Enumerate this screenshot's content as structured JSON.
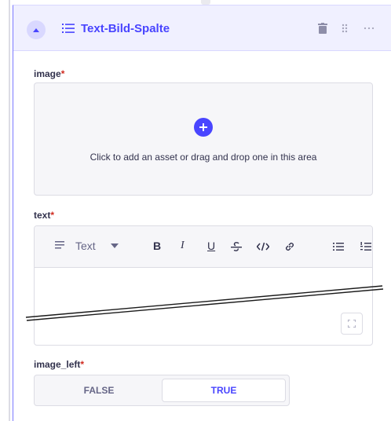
{
  "header": {
    "title": "Text-Bild-Spalte"
  },
  "fields": {
    "image": {
      "label": "image",
      "required_mark": "*",
      "drop_text": "Click to add an asset or drag and drop one in this area"
    },
    "text": {
      "label": "text",
      "required_mark": "*",
      "heading_select": "Text"
    },
    "image_left": {
      "label": "image_left",
      "required_mark": "*",
      "options": [
        "FALSE",
        "TRUE"
      ],
      "selected": "TRUE"
    }
  },
  "toolbar": {
    "bold": "B",
    "italic": "I",
    "underline": "U"
  },
  "icons": [
    "chevron-up-icon",
    "list-icon",
    "trash-icon",
    "drag-handle-icon",
    "more-icon",
    "plus-icon",
    "align-left-icon",
    "caret-down-icon",
    "strikethrough-icon",
    "code-icon",
    "link-icon",
    "bullet-list-icon",
    "numbered-list-icon",
    "expand-icon"
  ],
  "colors": {
    "accent": "#4945ff",
    "header_bg": "#f0f0ff",
    "required": "#d02b20"
  }
}
